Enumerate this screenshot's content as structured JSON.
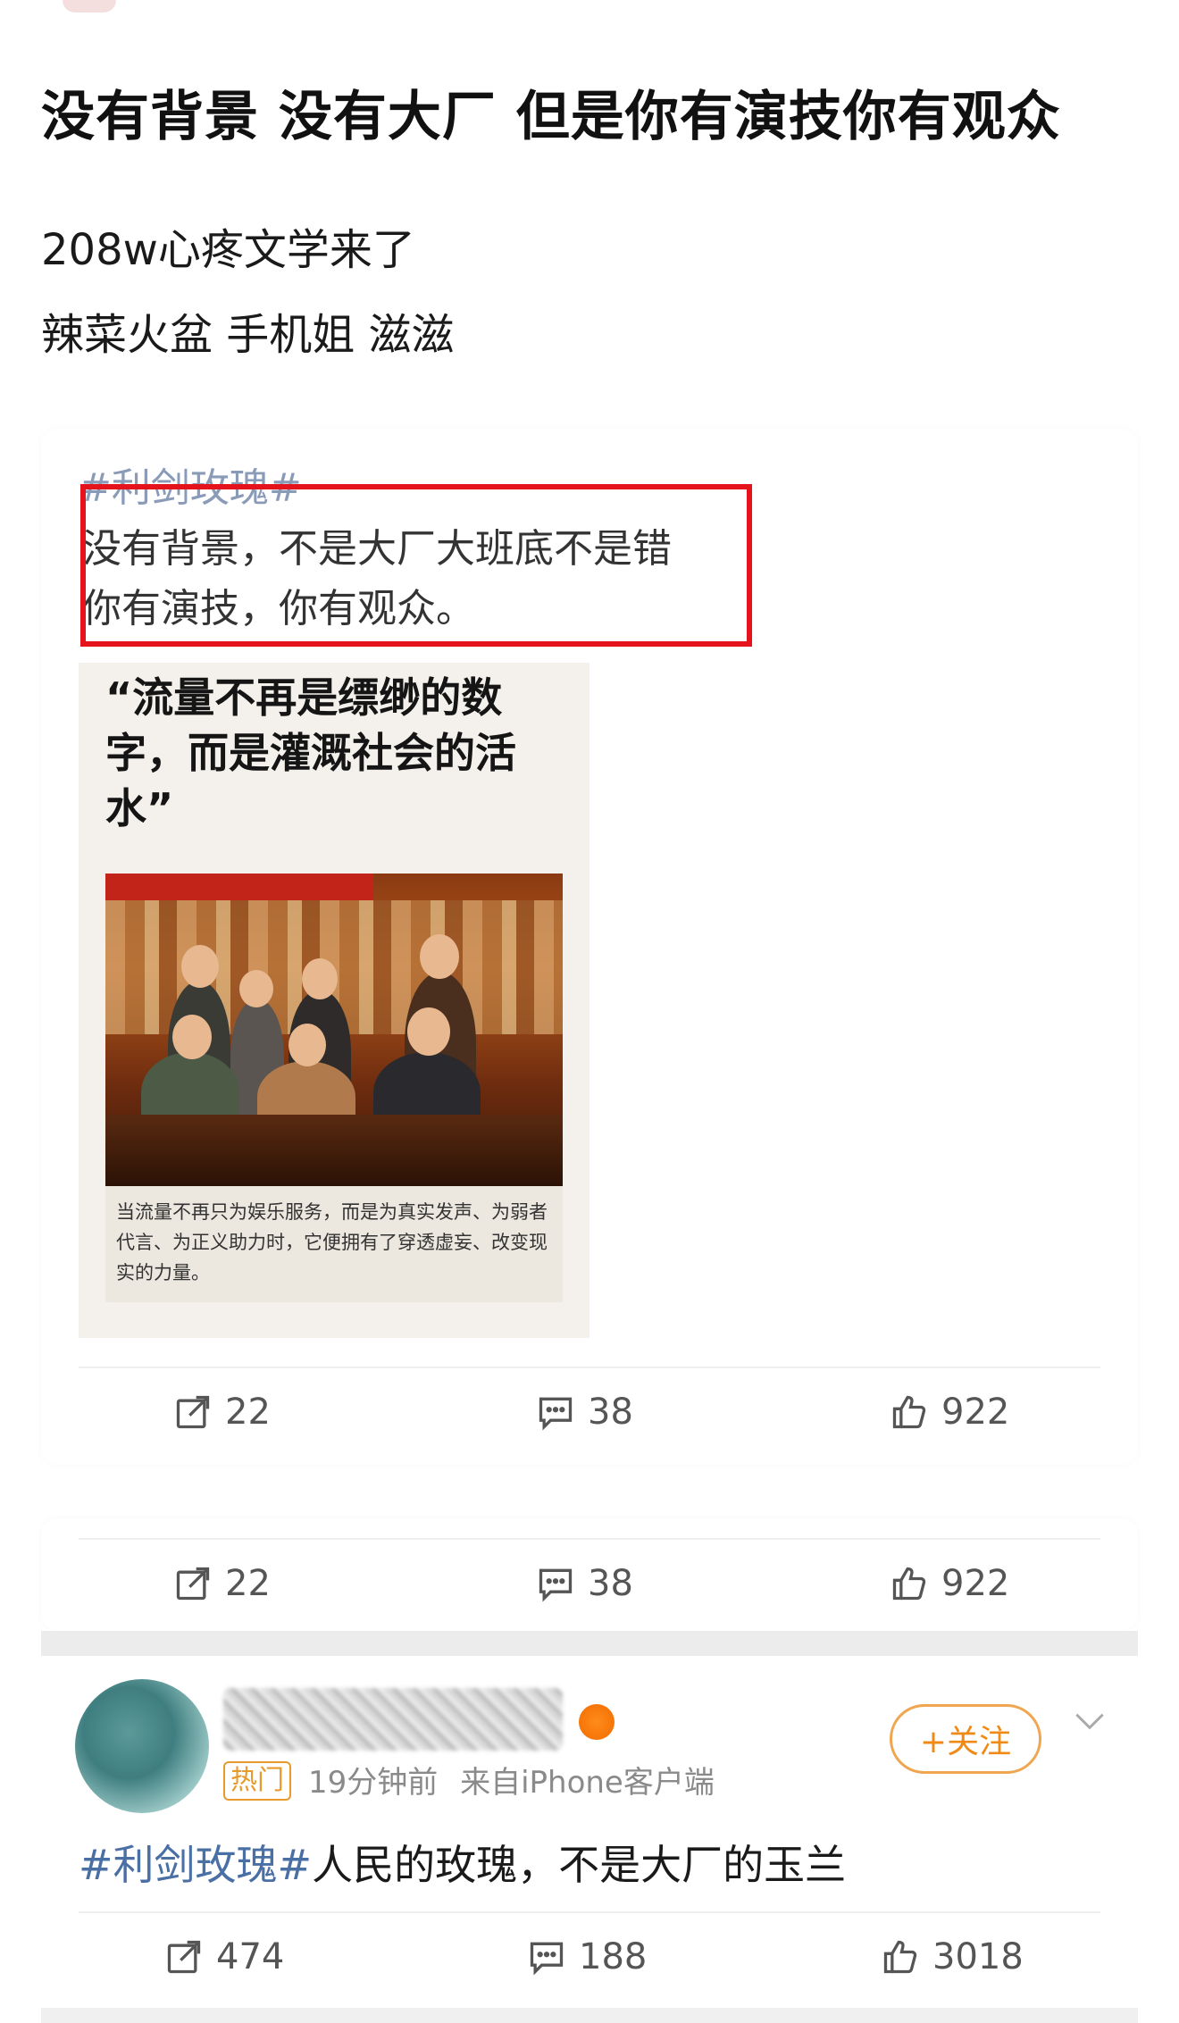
{
  "post": {
    "title": "没有背景 没有大厂 但是你有演技你有观众",
    "line1": "208w心疼文学来了",
    "line2": "辣菜火盆 手机姐 滋滋"
  },
  "quoted_card": {
    "hashtag": "#利剑玫瑰#",
    "quote_line1": "没有背景，不是大厂大班底不是错",
    "quote_line2": "你有演技，你有观众。",
    "highlight_color": "#e5141c",
    "poster": {
      "headline": "“流量不再是缥缈的数字，而是灌溉社会的活水”",
      "caption": "当流量不再只为娱乐服务，而是为真实发声、为弱者代言、为正义助力时，它便拥有了穿透虚妄、改变现实的力量。"
    },
    "stats": {
      "share": "22",
      "comment": "38",
      "like": "922"
    }
  },
  "second_card": {
    "stats": {
      "share": "22",
      "comment": "38",
      "like": "922"
    }
  },
  "comment_post": {
    "hot_label": "热门",
    "time": "19分钟前",
    "source": "来自iPhone客户端",
    "follow_label": "+关注",
    "text_tag": "#利剑玫瑰#",
    "text_body": "人民的玫瑰，不是大厂的玉兰",
    "stats": {
      "share": "474",
      "comment": "188",
      "like": "3018"
    },
    "accent_color": "#f08a17",
    "tag_color": "#4a6fa5"
  }
}
